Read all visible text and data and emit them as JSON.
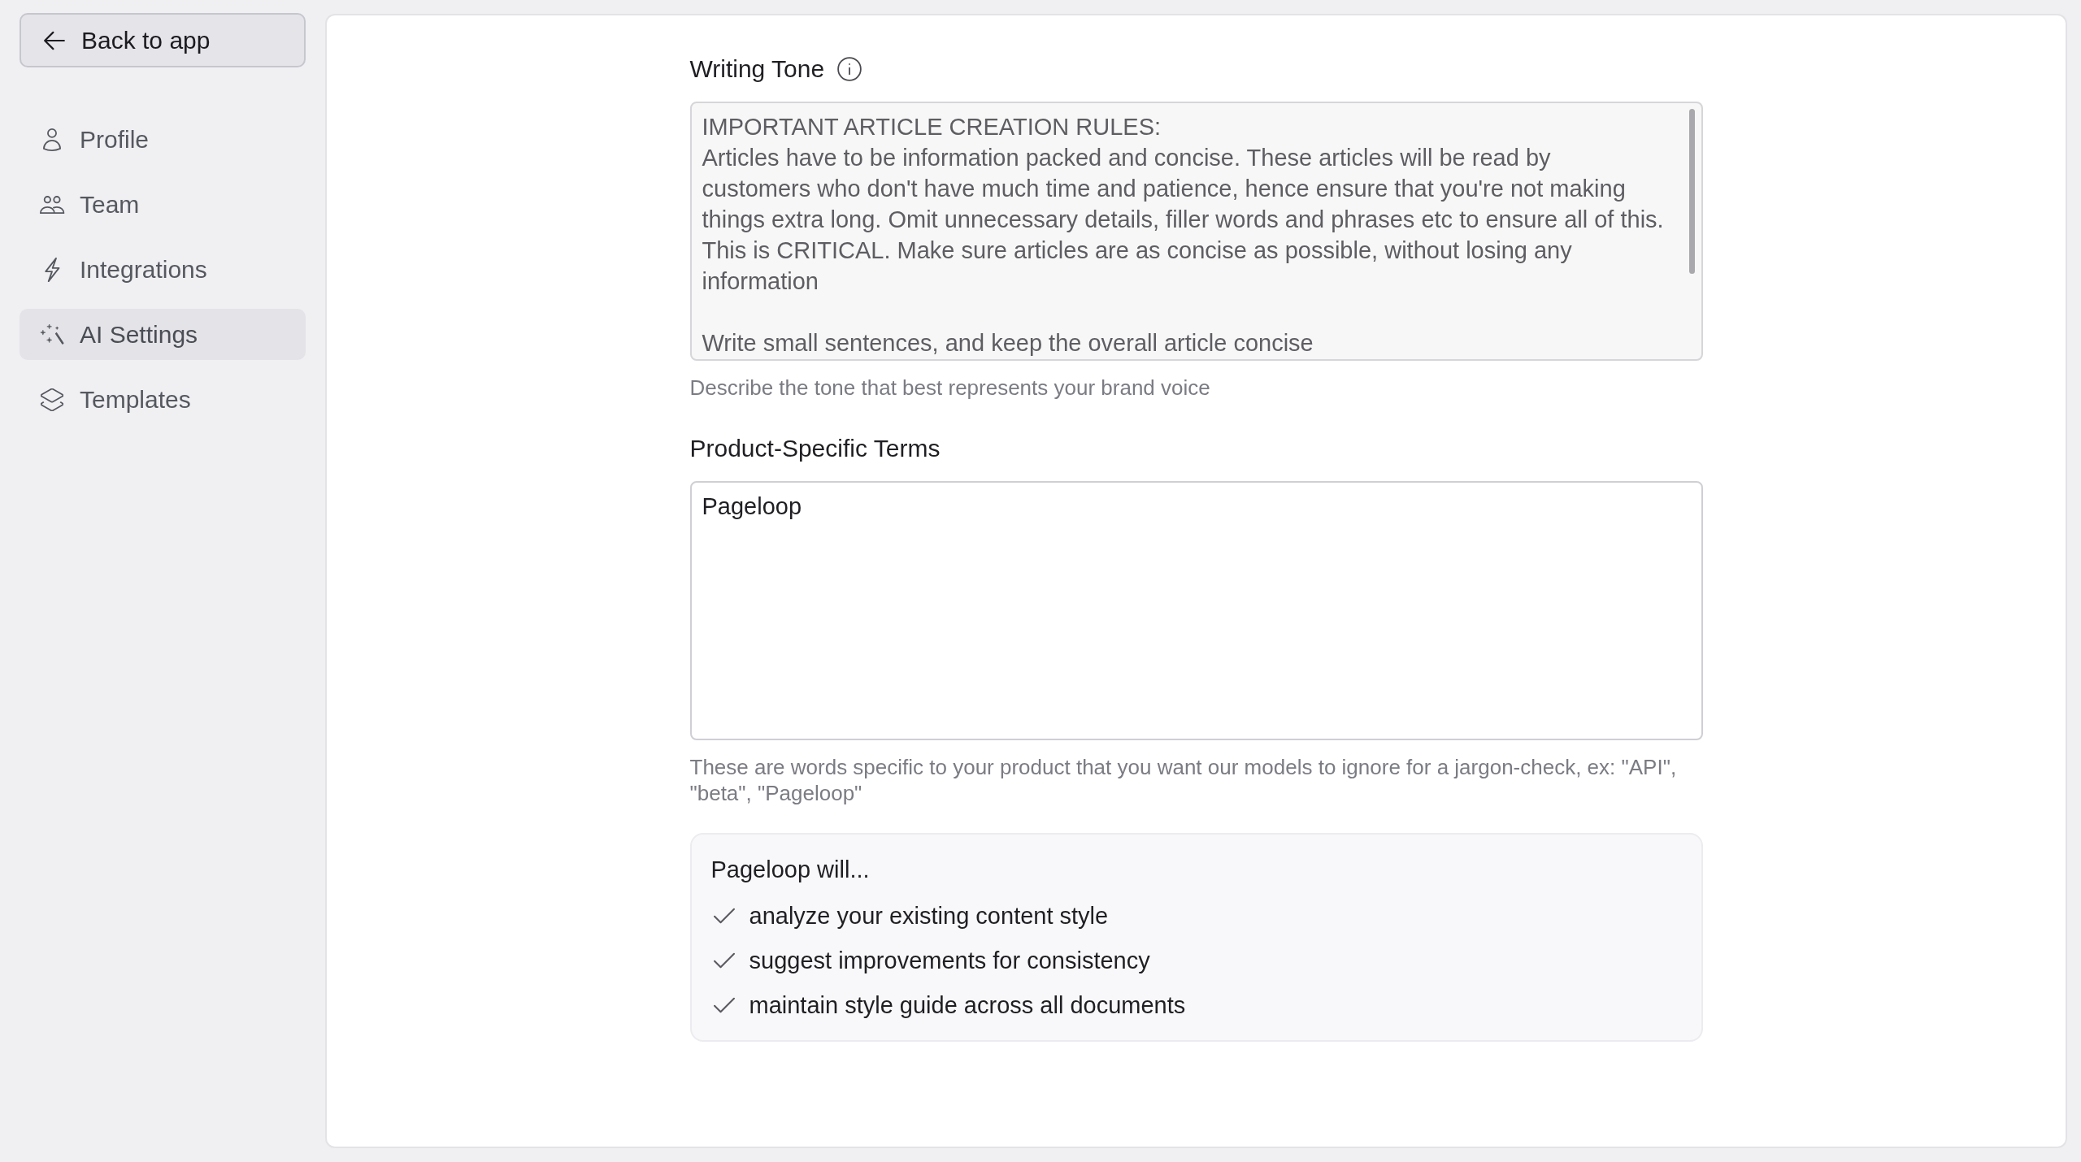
{
  "sidebar": {
    "back_button": {
      "label": "Back to app"
    },
    "items": [
      {
        "label": "Profile",
        "selected": false
      },
      {
        "label": "Team",
        "selected": false
      },
      {
        "label": "Integrations",
        "selected": false
      },
      {
        "label": "AI Settings",
        "selected": true
      },
      {
        "label": "Templates",
        "selected": false
      }
    ]
  },
  "fields": [
    {
      "label": "Writing Tone",
      "info": true,
      "value": "IMPORTANT ARTICLE CREATION RULES:\nArticles have to be information packed and concise. These articles will be read by\ncustomers who don't have much time and patience, hence ensure that you're not making\nthings extra long. Omit unnecessary details, filler words and phrases etc to ensure all of this.\nThis is CRITICAL. Make sure articles are as concise as possible, without losing any\ninformation\n\nWrite small sentences, and keep the overall article concise",
      "disabled": true,
      "hint": "Describe the tone that best represents your brand voice"
    },
    {
      "label": "Product-Specific Terms",
      "info": false,
      "value": "Pageloop",
      "disabled": false,
      "hint": "These are words specific to your product that you want our models to ignore for a jargon-check, ex: \"API\", \"beta\", \"Pageloop\""
    }
  ],
  "summary": {
    "title": "Pageloop will...",
    "items": [
      "analyze your existing content style",
      "suggest improvements for consistency",
      "maintain style guide across all documents"
    ]
  }
}
